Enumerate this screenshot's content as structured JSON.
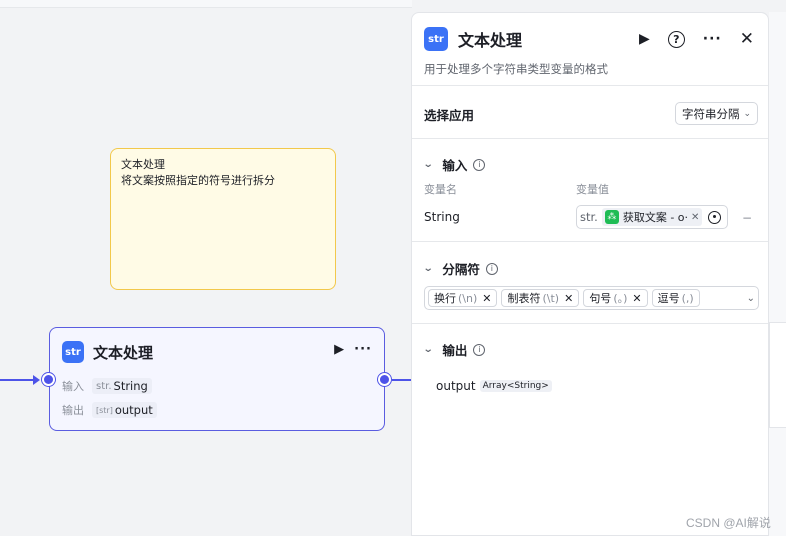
{
  "note": {
    "title": "文本处理",
    "body": "将文案按照指定的符号进行拆分"
  },
  "node": {
    "icon": "str",
    "title": "文本处理",
    "input_label": "输入",
    "input_prefix": "str.",
    "input_value": "String",
    "output_label": "输出",
    "output_prefix": "[str]",
    "output_value": "output"
  },
  "panel": {
    "icon": "str",
    "title": "文本处理",
    "description": "用于处理多个字符串类型变量的格式",
    "select_app_label": "选择应用",
    "select_app_value": "字符串分隔",
    "input_section": {
      "title": "输入",
      "col_name": "变量名",
      "col_value": "变量值",
      "var_name": "String",
      "var_prefix": "str.",
      "ref_label": "获取文案 - o·",
      "minus": "−"
    },
    "separator_section": {
      "title": "分隔符",
      "chips": [
        {
          "label": "换行",
          "sub": "(\\n)"
        },
        {
          "label": "制表符",
          "sub": "(\\t)"
        },
        {
          "label": "句号",
          "sub": "(。)"
        },
        {
          "label": "逗号",
          "sub": "(,)"
        }
      ]
    },
    "output_section": {
      "title": "输出",
      "var_name": "output",
      "var_type": "Array<String>"
    }
  },
  "watermark": "CSDN @AI解说",
  "colors": {
    "accent": "#4d53e8",
    "app_icon": "#3b72f6",
    "ref_icon": "#1fbc55",
    "note_border": "#f2c84b"
  },
  "icons": [
    "play-icon",
    "more-icon",
    "help-icon",
    "close-icon",
    "chevron-down-icon",
    "info-icon",
    "target-icon"
  ]
}
